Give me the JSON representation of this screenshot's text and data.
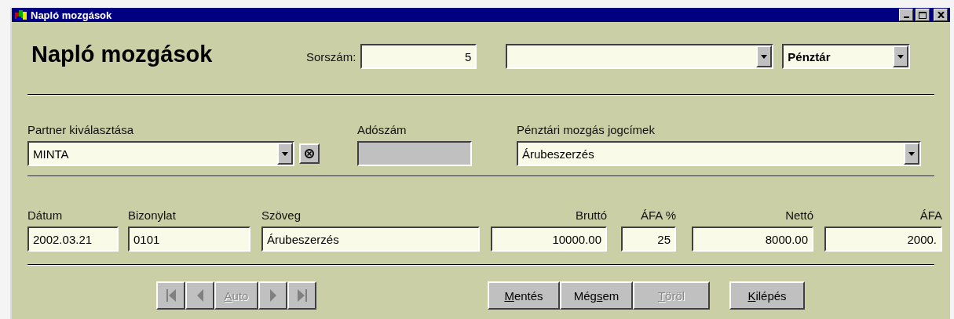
{
  "window": {
    "title": "Napló mozgások"
  },
  "header": {
    "title": "Napló mozgások",
    "serial_label": "Sorszám:",
    "serial_value": "5",
    "register": "Pénztár"
  },
  "partner": {
    "label": "Partner kiválasztása",
    "value": "MINTA"
  },
  "tax_number": {
    "label": "Adószám"
  },
  "reason": {
    "label": "Pénztári mozgás jogcímek",
    "value": "Árubeszerzés"
  },
  "fields": [
    {
      "label": "Dátum",
      "value": "2002.03.21",
      "kind": "text"
    },
    {
      "label": "Bizonylat",
      "value": "0101",
      "kind": "text"
    },
    {
      "label": "Szöveg",
      "value": "Árubeszerzés",
      "kind": "text"
    },
    {
      "label": "Bruttó",
      "value": "10000.00",
      "kind": "number"
    },
    {
      "label": "ÁFA %",
      "value": "25",
      "kind": "number"
    },
    {
      "label": "Nettó",
      "value": "8000.00",
      "kind": "number"
    },
    {
      "label": "ÁFA",
      "value": "2000.",
      "kind": "number"
    }
  ],
  "navigator": [
    {
      "kind": "first",
      "disabled": true
    },
    {
      "kind": "prev",
      "disabled": true
    },
    {
      "kind": "text",
      "key": "A",
      "after": "uto",
      "disabled": true
    },
    {
      "kind": "next",
      "disabled": true
    },
    {
      "kind": "last",
      "disabled": true
    }
  ],
  "actions": [
    {
      "key": "M",
      "after": "entés",
      "disabled": false
    },
    {
      "before": "Még",
      "key": "s",
      "after": "em",
      "disabled": false
    },
    {
      "key": "T",
      "after": "öröl",
      "disabled": true
    }
  ],
  "exit": {
    "key": "K",
    "after": "ilépés",
    "disabled": false
  }
}
